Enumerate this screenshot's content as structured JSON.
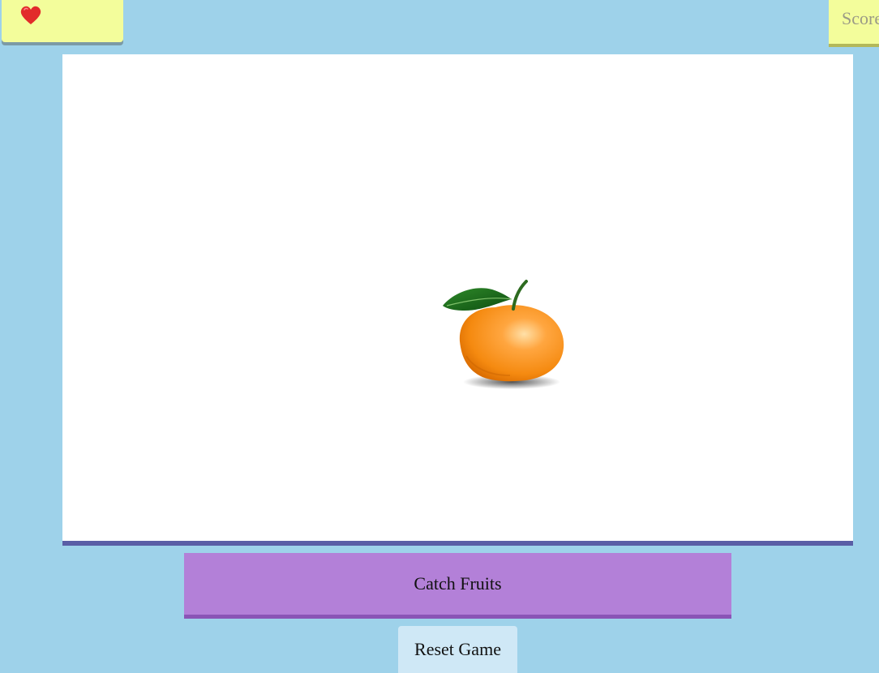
{
  "hud": {
    "lives_icon": "heart-icon",
    "score_label": "Score"
  },
  "game": {
    "fruit": "orange",
    "title": "Catch Fruits",
    "reset_label": "Reset Game"
  },
  "colors": {
    "background": "#9ed2ea",
    "hud_panel": "#f3fd9b",
    "heart": "#e22b2b",
    "title_bar": "#b380d8",
    "game_border": "#5a5ea6",
    "reset_button": "#cfe8f6"
  }
}
